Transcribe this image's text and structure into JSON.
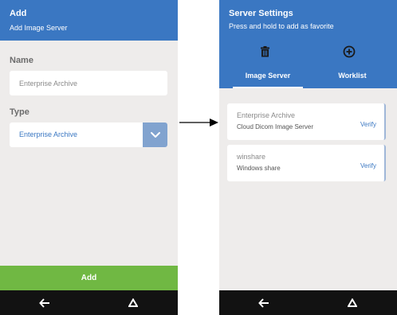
{
  "left_screen": {
    "header": {
      "title": "Add",
      "subtitle": "Add Image Server"
    },
    "name_field": {
      "label": "Name",
      "placeholder": "Enterprise Archive"
    },
    "type_field": {
      "label": "Type",
      "value": "Enterprise Archive",
      "icon": "chevron-down-icon"
    },
    "add_button": {
      "label": "Add",
      "color": "#70b843"
    },
    "navbar": {
      "icons": [
        "back-arrow-icon",
        "home-triangle-icon"
      ]
    }
  },
  "right_screen": {
    "header": {
      "title": "Server Settings",
      "subtitle": "Press and hold to add as favorite"
    },
    "actions": [
      "trash-icon",
      "add-circle-icon"
    ],
    "tabs": [
      {
        "label": "Image Server",
        "active": true
      },
      {
        "label": "Worklist",
        "active": false
      }
    ],
    "servers": [
      {
        "name": "Enterprise Archive",
        "type": "Cloud Dicom Image Server",
        "action": "Verify"
      },
      {
        "name": "winshare",
        "type": "Windows share",
        "action": "Verify"
      }
    ],
    "navbar": {
      "icons": [
        "back-arrow-icon",
        "home-triangle-icon"
      ]
    }
  },
  "colors": {
    "primary": "#3a77c2",
    "accent_green": "#70b843",
    "background": "#eeeceb",
    "navbar": "#121212"
  }
}
